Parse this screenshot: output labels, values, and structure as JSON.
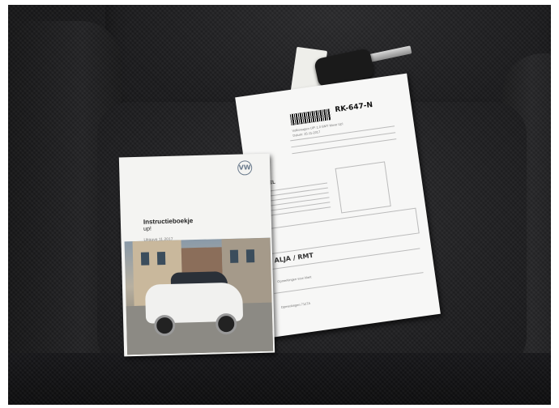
{
  "photo": {
    "description_tags": [
      "car-seat",
      "owner-manual",
      "car-key",
      "delivery-form"
    ]
  },
  "booklet": {
    "title": "Instructieboekje",
    "model": "up!",
    "edition": "Uitgave 11.2017",
    "plate_on_car": "",
    "brand_mark": "VW"
  },
  "form": {
    "plate": "RK-647-N",
    "doel_heading": "DOEL",
    "alja_rmt": "ALJA / RMT",
    "car_sig": "",
    "header_lines": [
      "Volkswagen UP! 1.0 BMT Move Up!",
      "Datum: 25-11-2017"
    ],
    "opmerkingen": "Opmerkingen voor klant",
    "aanvullende": "Opmerkingen  7127A"
  },
  "tag": {
    "label": "Zie aflevering"
  }
}
